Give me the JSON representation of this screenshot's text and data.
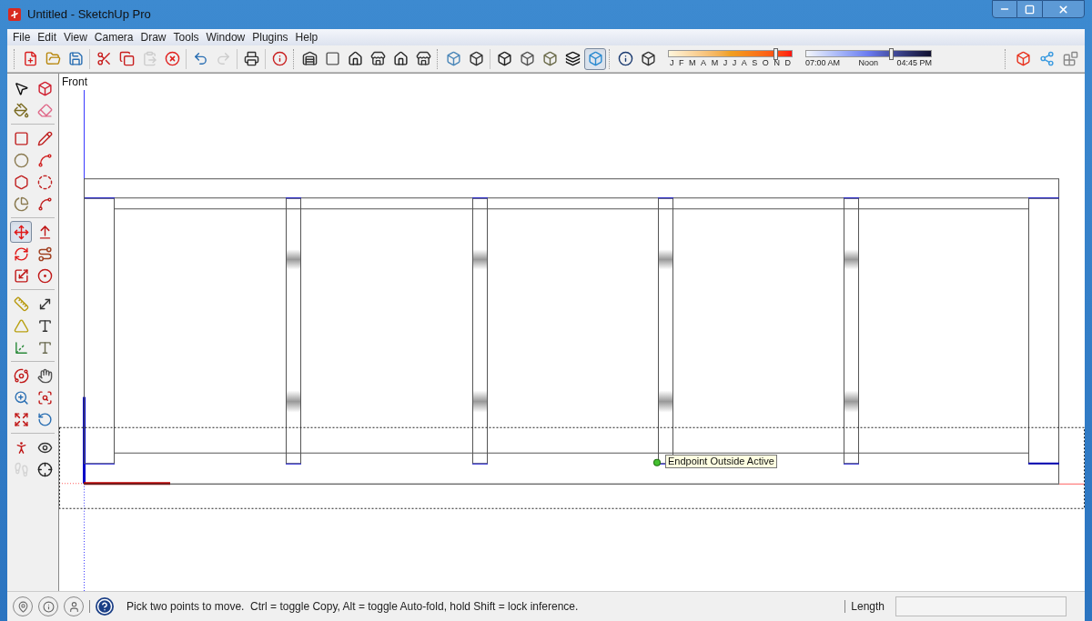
{
  "window": {
    "title": "Untitled - SketchUp Pro"
  },
  "menu": [
    {
      "label": "File"
    },
    {
      "label": "Edit"
    },
    {
      "label": "View"
    },
    {
      "label": "Camera"
    },
    {
      "label": "Draw"
    },
    {
      "label": "Tools"
    },
    {
      "label": "Window"
    },
    {
      "label": "Plugins"
    },
    {
      "label": "Help"
    }
  ],
  "toolbar": {
    "groups": [
      [
        {
          "kind": "new",
          "disabled": false,
          "selected": false
        },
        {
          "kind": "open",
          "disabled": false,
          "selected": false
        },
        {
          "kind": "save",
          "disabled": false,
          "selected": false
        }
      ],
      [
        {
          "kind": "cut",
          "disabled": false,
          "selected": false
        },
        {
          "kind": "copy",
          "disabled": false,
          "selected": false
        },
        {
          "kind": "paste",
          "disabled": true,
          "selected": false
        },
        {
          "kind": "erase",
          "disabled": false,
          "selected": false
        }
      ],
      [
        {
          "kind": "undo",
          "disabled": false,
          "selected": false
        },
        {
          "kind": "redo",
          "disabled": true,
          "selected": false
        }
      ],
      [
        {
          "kind": "print",
          "disabled": false,
          "selected": false
        }
      ],
      [
        {
          "kind": "model-info",
          "disabled": false,
          "selected": false
        }
      ],
      [
        {
          "kind": "iso",
          "disabled": false,
          "selected": false
        },
        {
          "kind": "top",
          "disabled": false,
          "selected": false
        },
        {
          "kind": "front",
          "disabled": false,
          "selected": false
        },
        {
          "kind": "right",
          "disabled": false,
          "selected": false
        },
        {
          "kind": "back",
          "disabled": false,
          "selected": false
        },
        {
          "kind": "left",
          "disabled": false,
          "selected": false
        }
      ],
      [
        {
          "kind": "xray",
          "disabled": false,
          "selected": false
        },
        {
          "kind": "back-edges",
          "disabled": false,
          "selected": false
        }
      ],
      [
        {
          "kind": "wireframe",
          "disabled": false,
          "selected": false
        },
        {
          "kind": "hidden-line",
          "disabled": false,
          "selected": false
        },
        {
          "kind": "shaded",
          "disabled": false,
          "selected": false
        },
        {
          "kind": "textured",
          "disabled": false,
          "selected": false
        },
        {
          "kind": "monochrome",
          "disabled": false,
          "selected": true
        }
      ],
      [
        {
          "kind": "shadow-settings",
          "disabled": false,
          "selected": false
        },
        {
          "kind": "display-shadows",
          "disabled": false,
          "selected": false
        }
      ]
    ],
    "month_slider": {
      "level": 0.87,
      "labels": [
        "J",
        "F",
        "M",
        "A",
        "M",
        "J",
        "J",
        "A",
        "S",
        "O",
        "N",
        "D"
      ]
    },
    "time_slider": {
      "level": 0.68,
      "labels": [
        "07:00 AM",
        "Noon",
        "04:45 PM"
      ]
    },
    "extras": [
      {
        "kind": "warehouse",
        "disabled": false,
        "selected": false
      },
      {
        "kind": "share",
        "disabled": false,
        "selected": false
      },
      {
        "kind": "extension",
        "disabled": false,
        "selected": false
      }
    ]
  },
  "tools": [
    [
      {
        "kind": "select",
        "selected": false,
        "disabled": false
      },
      {
        "kind": "component",
        "selected": false,
        "disabled": false
      },
      {
        "kind": "paint",
        "selected": false,
        "disabled": false
      },
      {
        "kind": "eraser",
        "selected": false,
        "disabled": false
      }
    ],
    [
      {
        "kind": "rectangle",
        "selected": false,
        "disabled": false
      },
      {
        "kind": "line",
        "selected": false,
        "disabled": false
      },
      {
        "kind": "circle",
        "selected": false,
        "disabled": false
      },
      {
        "kind": "freehand",
        "selected": false,
        "disabled": false
      },
      {
        "kind": "polygon",
        "selected": false,
        "disabled": false
      },
      {
        "kind": "arc",
        "selected": false,
        "disabled": false
      },
      {
        "kind": "pie",
        "selected": false,
        "disabled": false
      },
      {
        "kind": "arc3",
        "selected": false,
        "disabled": false
      }
    ],
    [
      {
        "kind": "move",
        "selected": true,
        "disabled": false
      },
      {
        "kind": "pushpull",
        "selected": false,
        "disabled": false
      },
      {
        "kind": "rotate",
        "selected": false,
        "disabled": false
      },
      {
        "kind": "followme",
        "selected": false,
        "disabled": false
      },
      {
        "kind": "scale",
        "selected": false,
        "disabled": false
      },
      {
        "kind": "offset",
        "selected": false,
        "disabled": false
      }
    ],
    [
      {
        "kind": "tape",
        "selected": false,
        "disabled": false
      },
      {
        "kind": "dimension",
        "selected": false,
        "disabled": false
      },
      {
        "kind": "protractor",
        "selected": false,
        "disabled": false
      },
      {
        "kind": "text",
        "selected": false,
        "disabled": false
      },
      {
        "kind": "axes",
        "selected": false,
        "disabled": false
      },
      {
        "kind": "text3d",
        "selected": false,
        "disabled": false
      }
    ],
    [
      {
        "kind": "orbit",
        "selected": false,
        "disabled": false
      },
      {
        "kind": "pan",
        "selected": false,
        "disabled": false
      },
      {
        "kind": "zoom",
        "selected": false,
        "disabled": false
      },
      {
        "kind": "zoom-window",
        "selected": false,
        "disabled": false
      },
      {
        "kind": "zoom-extents",
        "selected": false,
        "disabled": false
      },
      {
        "kind": "previous",
        "selected": false,
        "disabled": false
      }
    ],
    [
      {
        "kind": "position-camera",
        "selected": false,
        "disabled": false
      },
      {
        "kind": "look-around",
        "selected": false,
        "disabled": false
      },
      {
        "kind": "walk",
        "selected": false,
        "disabled": true
      },
      {
        "kind": "section-plane",
        "selected": false,
        "disabled": false
      }
    ]
  ],
  "viewport": {
    "scene_label": "Front",
    "tooltip": "Endpoint Outside Active"
  },
  "status_bar": {
    "message": "Pick two points to move.  Ctrl = toggle Copy, Alt = toggle Auto-fold, hold Shift = lock inference.",
    "measure_label": "Length"
  }
}
